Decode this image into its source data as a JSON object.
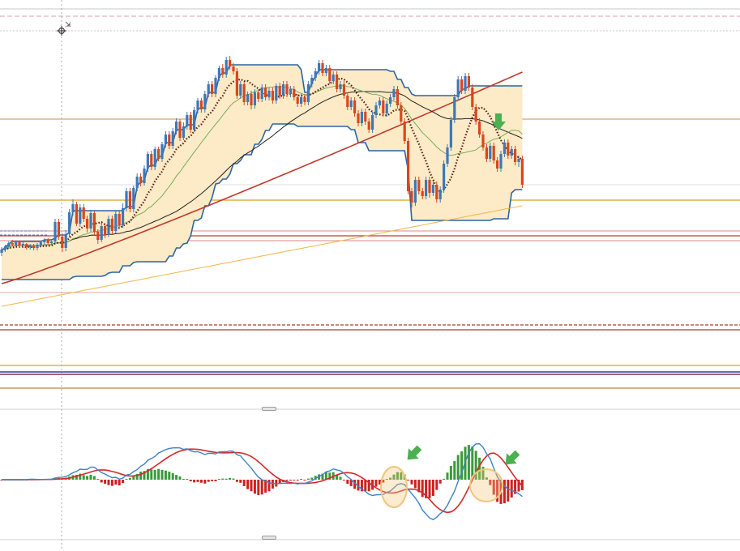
{
  "colors": {
    "background": "#ffffff",
    "bull_candle": "#3d78b8",
    "bear_candle": "#d9471c",
    "channel_fill": "#fdebc8",
    "channel_line": "#2b64a3",
    "sma_200": "#c0392b",
    "sma_long": "#f0b64a",
    "sma_mid": "#222222",
    "sma_fast": "#6aa84f",
    "dotted_ma": "#5a1a10",
    "macd_line": "#3d82c4",
    "signal_line": "#d62828",
    "hist_positive": "#3a9a3a",
    "hist_negative": "#cc2222",
    "marker_arrow": "#4caf50",
    "highlight_circle": "#f2c57c"
  },
  "icons": {
    "cursor": "crosshair-icon",
    "resize": "resize-cursor-icon",
    "markers": [
      "down-arrow-icon",
      "down-left-arrow-icon",
      "down-left-arrow-icon"
    ]
  },
  "panes": [
    "price",
    "macd"
  ],
  "chart_data": [
    {
      "type": "candlestick",
      "pane": "price",
      "grid": false,
      "legend": "none",
      "candles": [
        [
          312,
          308,
          316,
          305
        ],
        [
          308,
          304,
          311,
          302
        ],
        [
          304,
          300,
          307,
          298
        ],
        [
          300,
          302,
          304,
          296
        ],
        [
          302,
          299,
          305,
          297
        ],
        [
          299,
          303,
          306,
          297
        ],
        [
          303,
          301,
          306,
          299
        ],
        [
          301,
          305,
          308,
          300
        ],
        [
          305,
          303,
          308,
          301
        ],
        [
          303,
          306,
          309,
          301
        ],
        [
          306,
          302,
          309,
          300
        ],
        [
          302,
          299,
          305,
          297
        ],
        [
          299,
          296,
          302,
          294
        ],
        [
          296,
          300,
          303,
          294
        ],
        [
          300,
          298,
          303,
          296
        ],
        [
          298,
          274,
          300,
          270
        ],
        [
          274,
          292,
          296,
          270
        ],
        [
          292,
          306,
          311,
          288
        ],
        [
          306,
          289,
          310,
          284
        ],
        [
          289,
          262,
          293,
          258
        ],
        [
          262,
          252,
          266,
          246
        ],
        [
          252,
          276,
          279,
          249
        ],
        [
          276,
          256,
          280,
          252
        ],
        [
          256,
          270,
          274,
          252
        ],
        [
          270,
          282,
          287,
          266
        ],
        [
          282,
          263,
          286,
          259
        ],
        [
          263,
          286,
          290,
          260
        ],
        [
          286,
          296,
          301,
          283
        ],
        [
          296,
          279,
          299,
          275
        ],
        [
          279,
          290,
          294,
          276
        ],
        [
          290,
          270,
          293,
          266
        ],
        [
          270,
          285,
          289,
          266
        ],
        [
          285,
          264,
          288,
          261
        ],
        [
          264,
          278,
          282,
          260
        ],
        [
          278,
          257,
          281,
          251
        ],
        [
          257,
          236,
          261,
          232
        ],
        [
          236,
          258,
          262,
          232
        ],
        [
          258,
          232,
          262,
          229
        ],
        [
          232,
          218,
          236,
          214
        ],
        [
          218,
          226,
          230,
          214
        ],
        [
          226,
          208,
          229,
          204
        ],
        [
          208,
          190,
          212,
          187
        ],
        [
          190,
          206,
          210,
          186
        ],
        [
          206,
          184,
          210,
          181
        ],
        [
          184,
          196,
          199,
          181
        ],
        [
          196,
          178,
          200,
          175
        ],
        [
          178,
          166,
          182,
          162
        ],
        [
          166,
          180,
          184,
          162
        ],
        [
          180,
          162,
          184,
          158
        ],
        [
          162,
          150,
          166,
          146
        ],
        [
          150,
          170,
          174,
          147
        ],
        [
          170,
          156,
          173,
          151
        ],
        [
          156,
          142,
          160,
          138
        ],
        [
          142,
          160,
          164,
          138
        ],
        [
          160,
          136,
          163,
          132
        ],
        [
          136,
          124,
          140,
          121
        ],
        [
          124,
          135,
          139,
          121
        ],
        [
          135,
          116,
          139,
          112
        ],
        [
          116,
          104,
          120,
          100
        ],
        [
          104,
          116,
          120,
          100
        ],
        [
          116,
          96,
          120,
          93
        ],
        [
          96,
          84,
          100,
          81
        ],
        [
          84,
          92,
          96,
          79
        ],
        [
          92,
          74,
          96,
          70
        ],
        [
          74,
          82,
          86,
          69
        ],
        [
          82,
          88,
          92,
          78
        ],
        [
          88,
          118,
          122,
          84
        ],
        [
          118,
          104,
          122,
          100
        ],
        [
          104,
          126,
          130,
          101
        ],
        [
          126,
          116,
          130,
          113
        ],
        [
          116,
          130,
          135,
          112
        ],
        [
          130,
          114,
          134,
          110
        ],
        [
          114,
          122,
          126,
          110
        ],
        [
          122,
          108,
          126,
          104
        ],
        [
          108,
          120,
          124,
          104
        ],
        [
          120,
          112,
          124,
          108
        ],
        [
          112,
          124,
          128,
          108
        ],
        [
          124,
          106,
          128,
          103
        ],
        [
          106,
          118,
          122,
          102
        ],
        [
          118,
          104,
          122,
          100
        ],
        [
          104,
          116,
          120,
          100
        ],
        [
          116,
          110,
          120,
          106
        ],
        [
          110,
          120,
          124,
          106
        ],
        [
          120,
          128,
          132,
          116
        ],
        [
          128,
          120,
          132,
          116
        ],
        [
          120,
          126,
          130,
          116
        ],
        [
          126,
          104,
          130,
          100
        ],
        [
          104,
          96,
          108,
          92
        ],
        [
          96,
          88,
          100,
          84
        ],
        [
          88,
          78,
          92,
          74
        ],
        [
          78,
          90,
          94,
          74
        ],
        [
          90,
          84,
          94,
          80
        ],
        [
          84,
          100,
          104,
          80
        ],
        [
          100,
          92,
          104,
          88
        ],
        [
          92,
          110,
          114,
          88
        ],
        [
          110,
          104,
          114,
          100
        ],
        [
          104,
          118,
          122,
          100
        ],
        [
          118,
          132,
          136,
          114
        ],
        [
          132,
          124,
          136,
          120
        ],
        [
          124,
          140,
          144,
          120
        ],
        [
          140,
          152,
          156,
          136
        ],
        [
          152,
          138,
          156,
          134
        ],
        [
          138,
          150,
          154,
          134
        ],
        [
          150,
          160,
          164,
          146
        ],
        [
          160,
          142,
          164,
          138
        ],
        [
          142,
          130,
          146,
          126
        ],
        [
          130,
          124,
          134,
          120
        ],
        [
          124,
          140,
          144,
          120
        ],
        [
          140,
          128,
          144,
          124
        ],
        [
          128,
          120,
          132,
          116
        ],
        [
          120,
          110,
          124,
          106
        ],
        [
          110,
          130,
          134,
          106
        ],
        [
          130,
          150,
          154,
          126
        ],
        [
          150,
          174,
          178,
          146
        ],
        [
          174,
          236,
          240,
          170
        ],
        [
          236,
          250,
          256,
          232
        ],
        [
          250,
          222,
          254,
          218
        ],
        [
          222,
          236,
          240,
          218
        ],
        [
          236,
          242,
          246,
          232
        ],
        [
          242,
          222,
          246,
          218
        ],
        [
          222,
          238,
          244,
          218
        ],
        [
          238,
          228,
          242,
          224
        ],
        [
          228,
          246,
          250,
          224
        ],
        [
          246,
          234,
          250,
          230
        ],
        [
          234,
          202,
          238,
          198
        ],
        [
          202,
          182,
          206,
          178
        ],
        [
          182,
          148,
          186,
          144
        ],
        [
          148,
          120,
          152,
          116
        ],
        [
          120,
          98,
          124,
          94
        ],
        [
          98,
          112,
          116,
          94
        ],
        [
          112,
          94,
          116,
          90
        ],
        [
          94,
          108,
          112,
          90
        ],
        [
          108,
          132,
          136,
          104
        ],
        [
          132,
          150,
          154,
          128
        ],
        [
          150,
          166,
          170,
          146
        ],
        [
          166,
          182,
          186,
          162
        ],
        [
          182,
          196,
          200,
          178
        ],
        [
          196,
          180,
          200,
          176
        ],
        [
          180,
          198,
          202,
          176
        ],
        [
          198,
          208,
          212,
          194
        ],
        [
          208,
          190,
          212,
          186
        ],
        [
          190,
          176,
          194,
          172
        ],
        [
          176,
          192,
          196,
          172
        ],
        [
          192,
          184,
          196,
          180
        ],
        [
          184,
          200,
          204,
          180
        ],
        [
          200,
          196,
          206,
          192
        ],
        [
          196,
          228,
          232,
          192
        ]
      ],
      "indicators": [
        "channel",
        "sma_200",
        "sma_long",
        "sma_mid",
        "sma_fast",
        "dotted_ma"
      ]
    },
    {
      "type": "bar",
      "pane": "macd",
      "grid": false,
      "legend": "none",
      "histogram": [
        -1,
        -1,
        -1,
        -1,
        -1,
        -1,
        -1,
        -1,
        -1,
        -1,
        -1,
        -1,
        -1,
        -1,
        -1,
        -1,
        -1,
        -1,
        -1,
        -1,
        -1,
        -1,
        -1,
        -1,
        -1,
        -1,
        -1,
        -1,
        -1,
        -1,
        -1,
        -1,
        -1,
        -1,
        -1,
        -1,
        -1,
        -1,
        -1,
        -1,
        -1,
        -1,
        -1,
        -1,
        -1,
        -1,
        -1,
        -1,
        -1,
        -1,
        -1,
        -1,
        -1,
        -1,
        -1,
        -1,
        -1,
        -1,
        -1,
        -1,
        -1,
        -1,
        -1,
        -1,
        -1,
        -1,
        -1,
        -1,
        -1,
        -1,
        -1,
        -1,
        -1,
        -1,
        -1,
        -1,
        -1,
        -1,
        -1,
        -1,
        -1,
        -1,
        -1,
        -1,
        -1,
        -1,
        -1,
        -1,
        -1,
        -1,
        -1,
        -1,
        -1,
        -1,
        -1,
        -1,
        -1,
        -1,
        -1,
        -1,
        -1,
        -1,
        -1,
        -1,
        -1,
        -1,
        -1,
        -1,
        -1,
        -1,
        -1,
        -1,
        -1,
        -1,
        -1,
        -1,
        -1,
        -1,
        -1,
        -1,
        -1,
        -1,
        -1,
        -1,
        -1,
        -1,
        -1,
        -1,
        -1,
        -1,
        -1,
        -1,
        -1,
        -1,
        -1,
        -1,
        -1,
        -1,
        -1,
        -1,
        -1,
        -1
      ]
    }
  ]
}
